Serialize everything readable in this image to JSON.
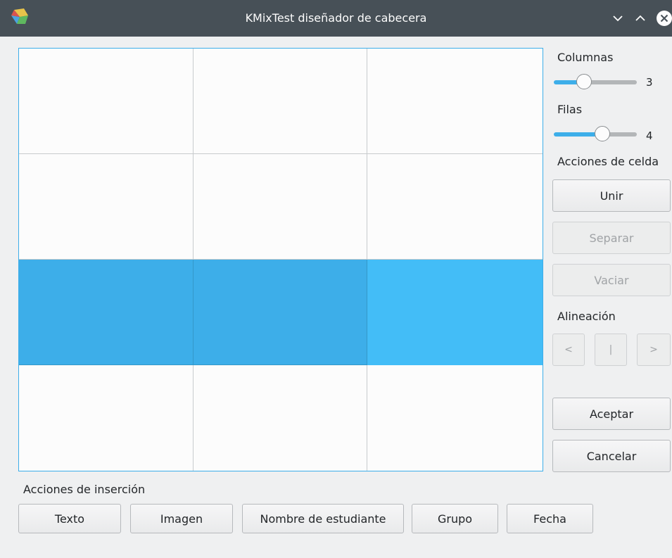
{
  "window": {
    "title": "KMixTest diseñador de cabecera"
  },
  "table": {
    "rows": 4,
    "cols": 3,
    "selected_row": 2,
    "current_col": 2
  },
  "sidebar": {
    "columns_label": "Columnas",
    "columns_value": "3",
    "columns_fraction": 0.33,
    "rows_label": "Filas",
    "rows_value": "4",
    "rows_fraction": 0.6,
    "cell_actions_label": "Acciones de celda",
    "merge_label": "Unir",
    "split_label": "Separar",
    "clear_label": "Vaciar",
    "alignment_label": "Alineación",
    "align_left_label": "<",
    "align_center_label": "|",
    "align_right_label": ">",
    "accept_label": "Aceptar",
    "cancel_label": "Cancelar"
  },
  "insert": {
    "label": "Acciones de inserción",
    "text_label": "Texto",
    "image_label": "Imagen",
    "student_name_label": "Nombre de estudiante",
    "group_label": "Grupo",
    "date_label": "Fecha"
  },
  "colors": {
    "accent": "#3daee9",
    "selection": "#3daee9",
    "current_cell": "#43bdf7",
    "titlebar": "#475057"
  }
}
